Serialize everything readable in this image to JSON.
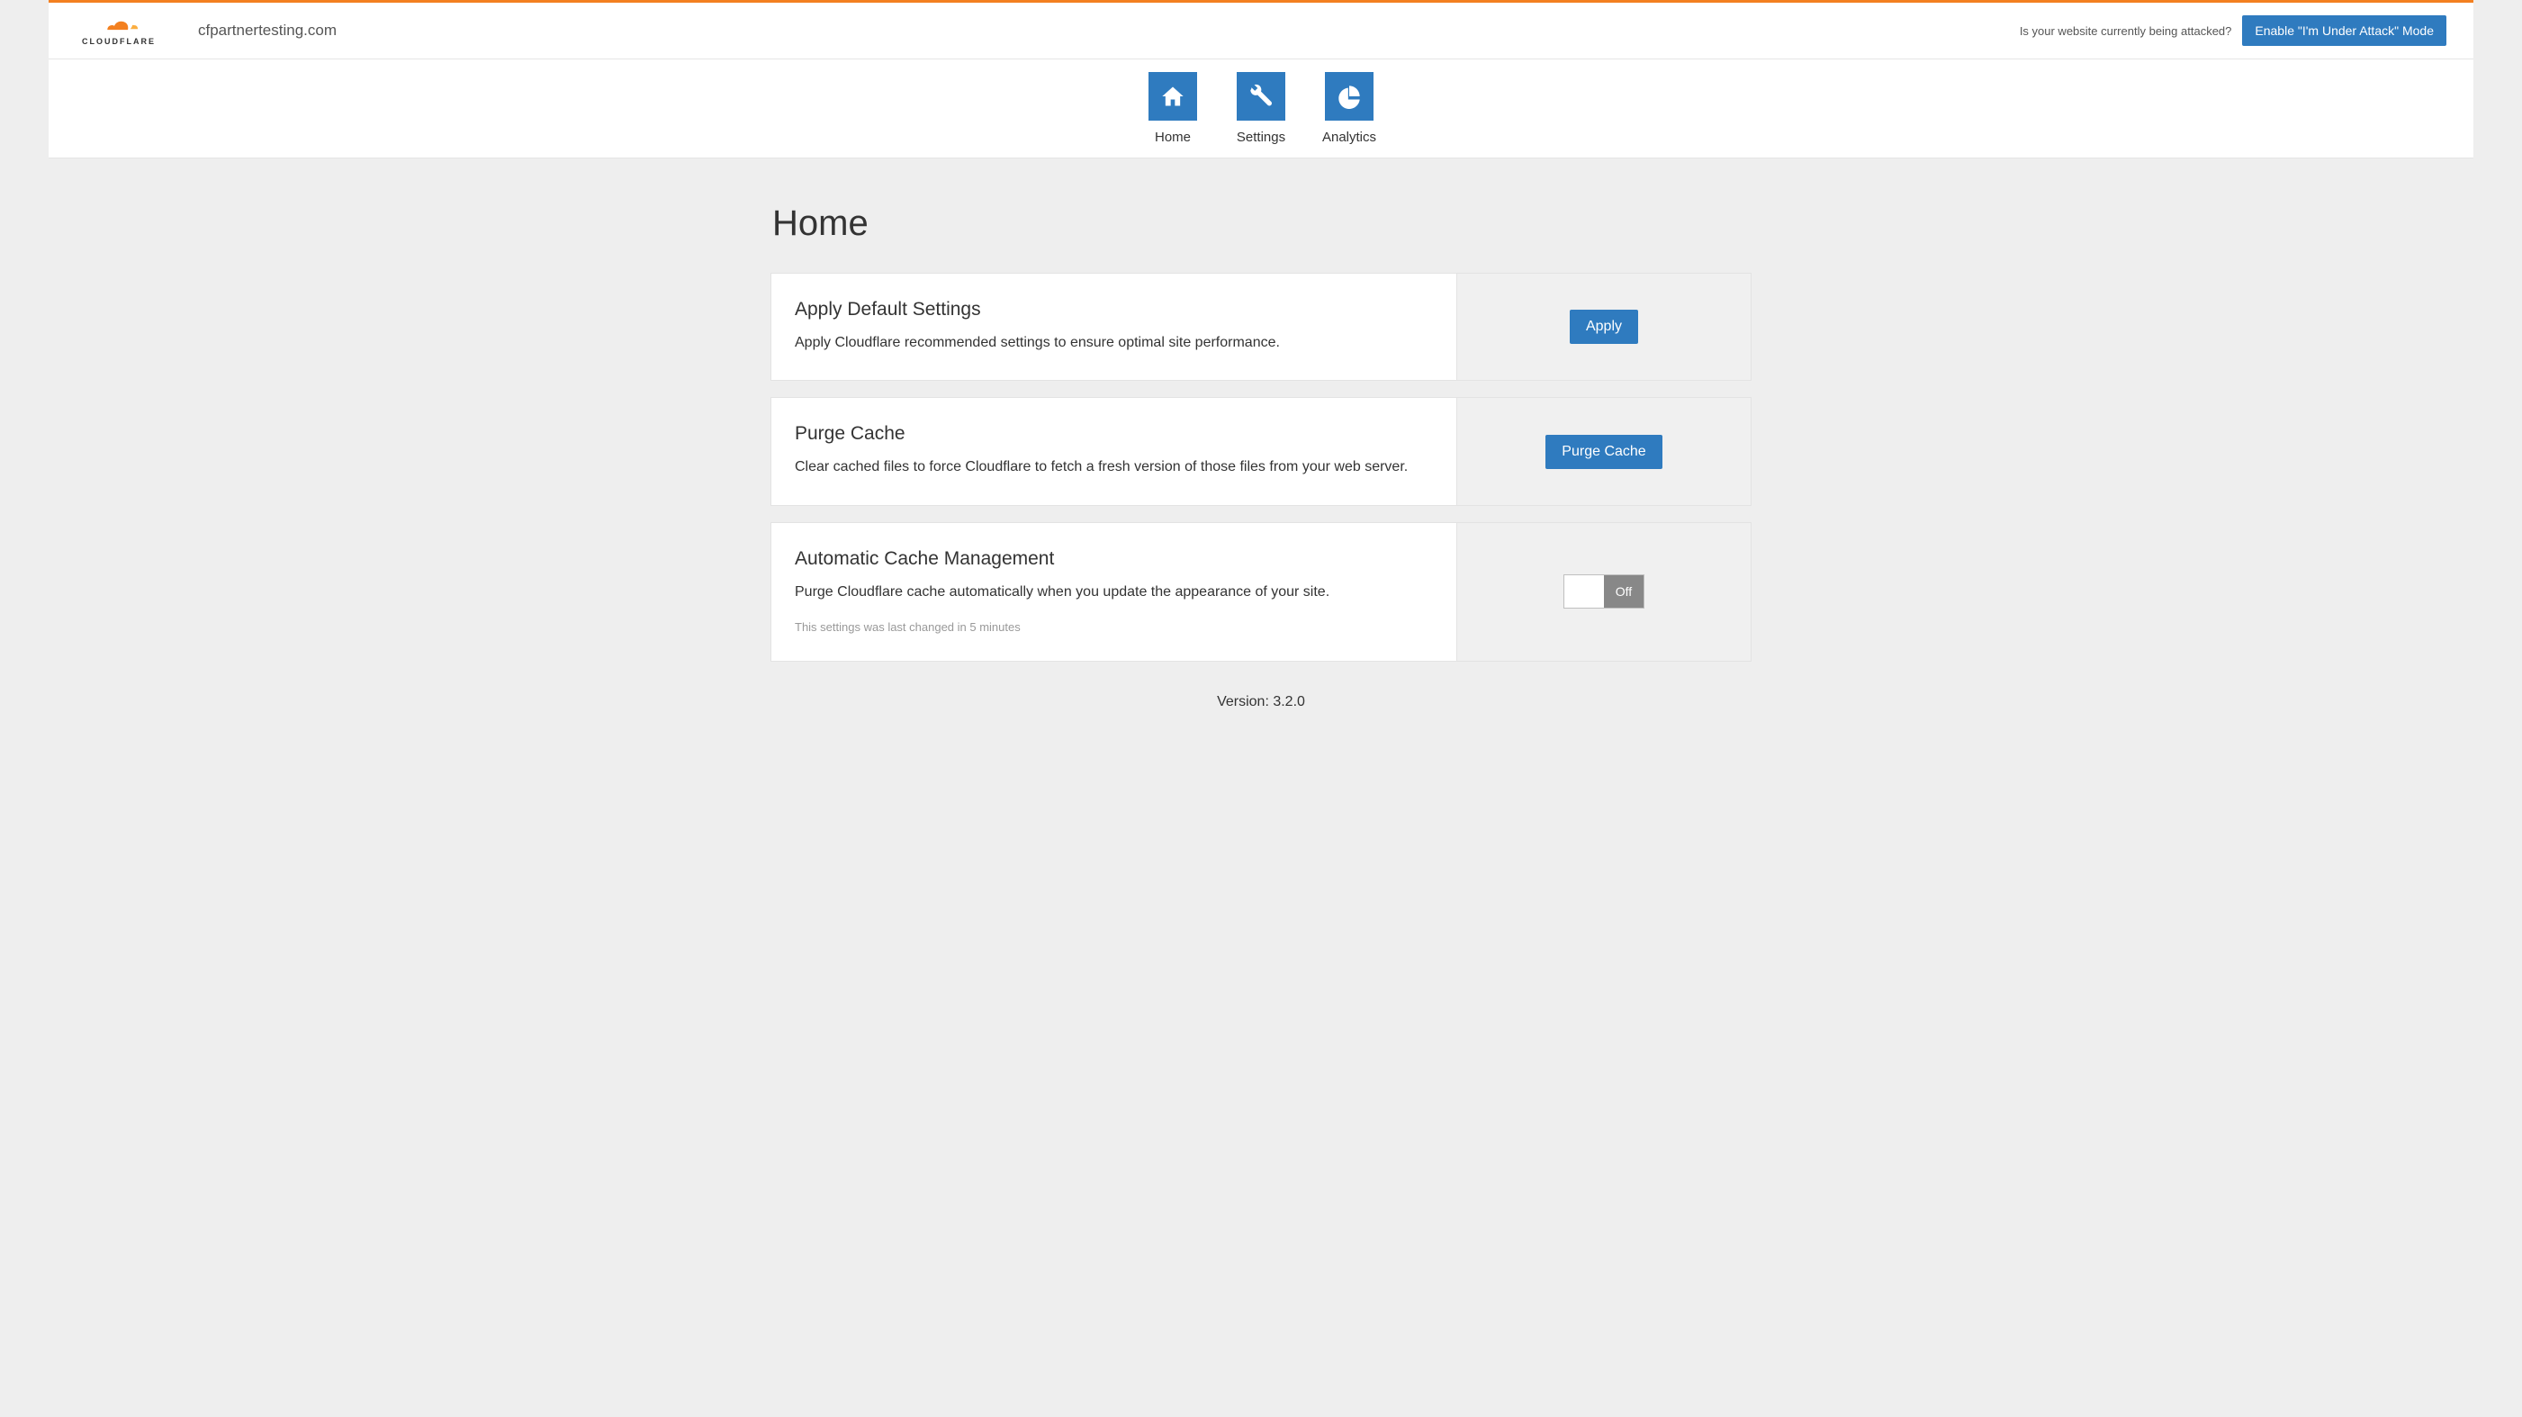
{
  "header": {
    "logo_text": "CLOUDFLARE",
    "domain": "cfpartnertesting.com",
    "attack_question": "Is your website currently being attacked?",
    "attack_button": "Enable \"I'm Under Attack\" Mode"
  },
  "nav": {
    "home": "Home",
    "settings": "Settings",
    "analytics": "Analytics"
  },
  "page": {
    "title": "Home"
  },
  "cards": {
    "apply_defaults": {
      "title": "Apply Default Settings",
      "desc": "Apply Cloudflare recommended settings to ensure optimal site performance.",
      "button": "Apply"
    },
    "purge_cache": {
      "title": "Purge Cache",
      "desc": "Clear cached files to force Cloudflare to fetch a fresh version of those files from your web server.",
      "button": "Purge Cache"
    },
    "auto_cache": {
      "title": "Automatic Cache Management",
      "desc": "Purge Cloudflare cache automatically when you update the appearance of your site.",
      "meta": "This settings was last changed in 5 minutes",
      "toggle_state": "Off"
    }
  },
  "footer": {
    "version": "Version: 3.2.0"
  }
}
